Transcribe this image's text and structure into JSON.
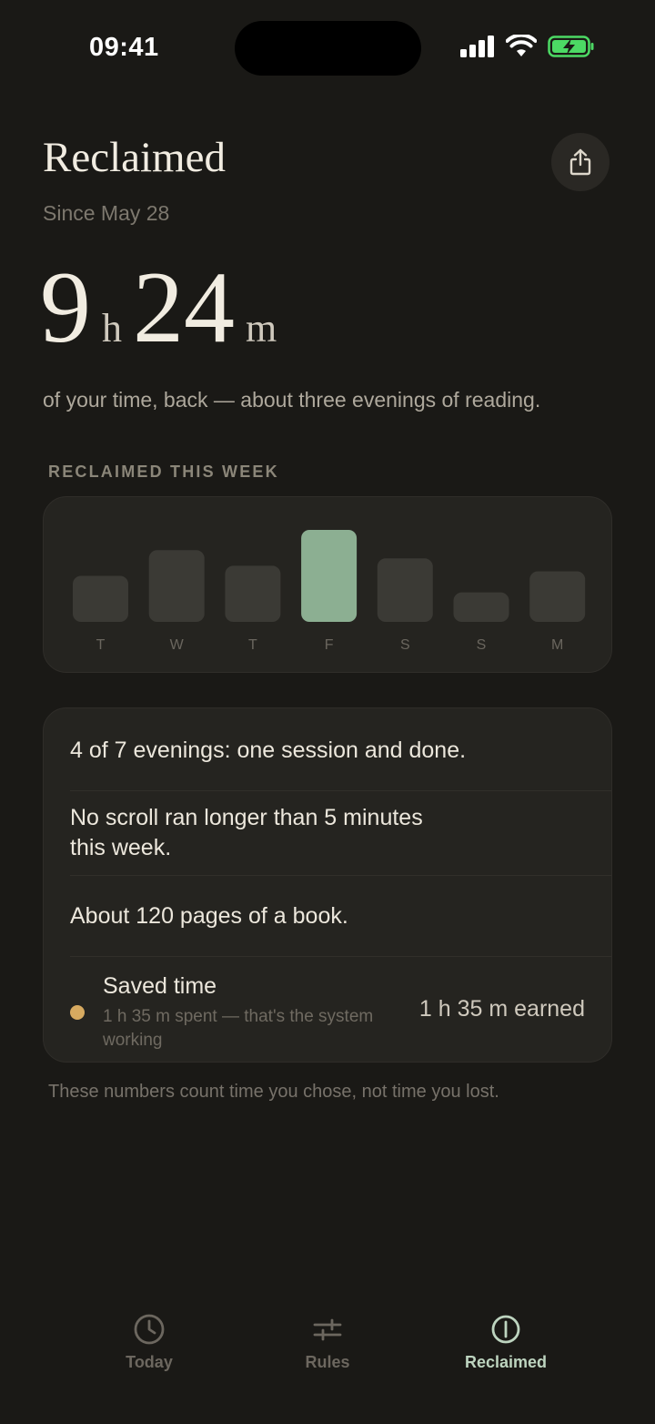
{
  "status_bar": {
    "time": "09:41"
  },
  "header": {
    "title": "Reclaimed",
    "subtitle": "Since May 28"
  },
  "total": {
    "hours": "9",
    "hours_unit": "h",
    "minutes": "24",
    "minutes_unit": "m"
  },
  "tagline": "of your time, back — about three evenings of reading.",
  "week_section": {
    "label": "RECLAIMED THIS WEEK"
  },
  "chart_data": {
    "type": "bar",
    "categories": [
      "T",
      "W",
      "T",
      "F",
      "S",
      "S",
      "M"
    ],
    "values": [
      0.5,
      0.78,
      0.61,
      1.0,
      0.69,
      0.32,
      0.55
    ],
    "highlight_index": 3,
    "bar_color": "#3b3a35",
    "highlight_color": "#8caf92",
    "grid": false
  },
  "stats": {
    "line1": "4 of 7 evenings: one session and done.",
    "line2a": "No scroll ran longer than 5 minutes",
    "line2b": "this week.",
    "line3": "About 120 pages of a book.",
    "saved_title": "Saved time",
    "saved_sub": "1 h 35 m spent — that's the system working",
    "saved_earned": "1 h 35 m earned"
  },
  "footnote": "These numbers count time you chose, not time you lost.",
  "tabs": [
    {
      "label": "Today",
      "icon": "clock-icon"
    },
    {
      "label": "Rules",
      "icon": "sliders-icon"
    },
    {
      "label": "Reclaimed",
      "icon": "reclaimed-icon"
    }
  ],
  "colors": {
    "accent": "#8caf92",
    "dot": "#d7aa60",
    "battery": "#4cd964"
  }
}
